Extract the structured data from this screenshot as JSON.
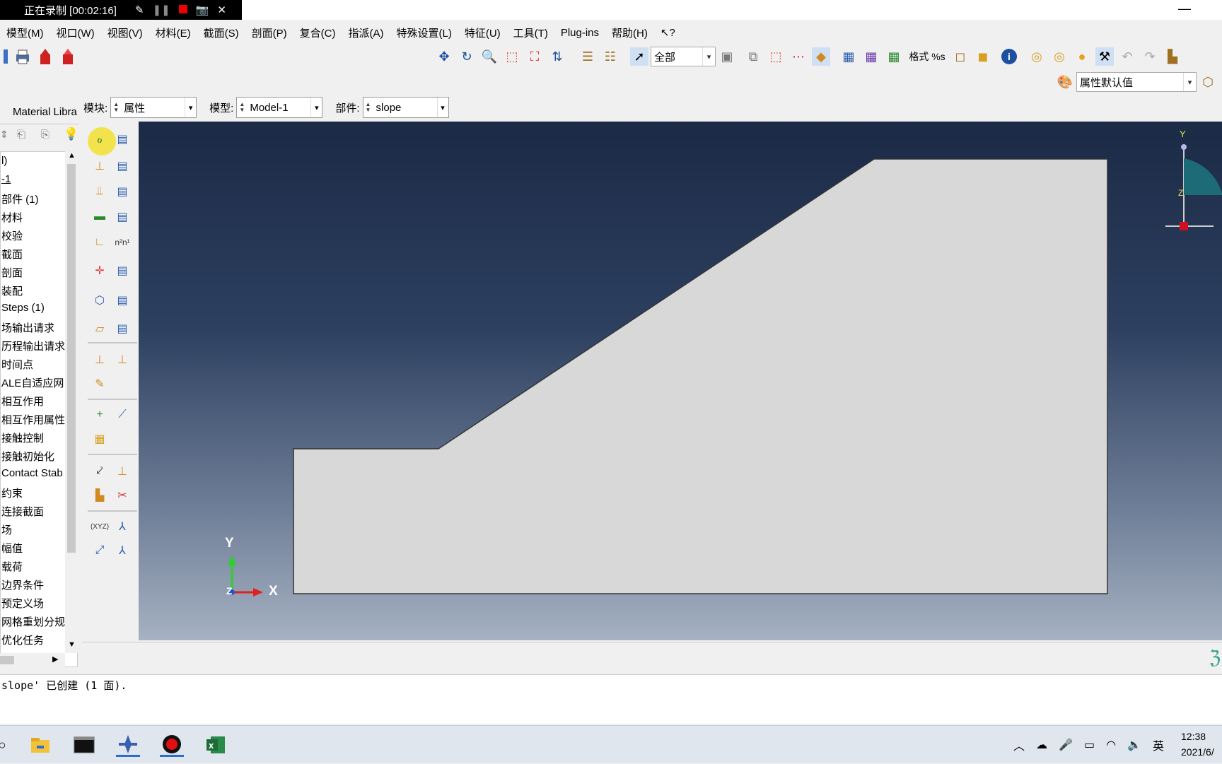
{
  "recording": {
    "label": "正在录制 [00:02:16]"
  },
  "menu": [
    "模型(M)",
    "视口(W)",
    "视图(V)",
    "材料(E)",
    "截面(S)",
    "剖面(P)",
    "复合(C)",
    "指派(A)",
    "特殊设置(L)",
    "特征(U)",
    "工具(T)",
    "Plug-ins",
    "帮助(H)",
    "⁂?"
  ],
  "toolbar": {
    "selection_filter": "全部",
    "format_label": "格式 %s",
    "attr_default": "属性默认值"
  },
  "context": {
    "module_label": "模块:",
    "module_value": "属性",
    "model_label": "模型:",
    "model_value": "Model-1",
    "part_label": "部件:",
    "part_value": "slope"
  },
  "tree": {
    "tab_label": "Material Libra",
    "items": [
      "l)",
      "-1",
      "部件 (1)",
      "材料",
      "校验",
      "截面",
      "剖面",
      "装配",
      "Steps (1)",
      "场输出请求",
      "历程输出请求",
      "时间点",
      "ALE自适应网",
      "相互作用",
      "相互作用属性",
      "接触控制",
      "接触初始化",
      "Contact Stab",
      "约束",
      "连接截面",
      "场",
      "幅值",
      "载荷",
      "边界条件",
      "预定义场",
      "网格重划分规",
      "优化任务"
    ]
  },
  "viewport": {
    "triad": {
      "x": "X",
      "y": "Y",
      "z": "Z"
    },
    "view_triad": {
      "y": "Y",
      "z": "Z"
    }
  },
  "message": "slope' 已创建 (1 面).",
  "tray": {
    "ime": "英",
    "time": "12:38",
    "date": "2021/6/"
  },
  "colors": {
    "part_fill": "#d8d8d8",
    "viewport_top": "#1b2a45",
    "viewport_bottom": "#a6b1c2"
  }
}
